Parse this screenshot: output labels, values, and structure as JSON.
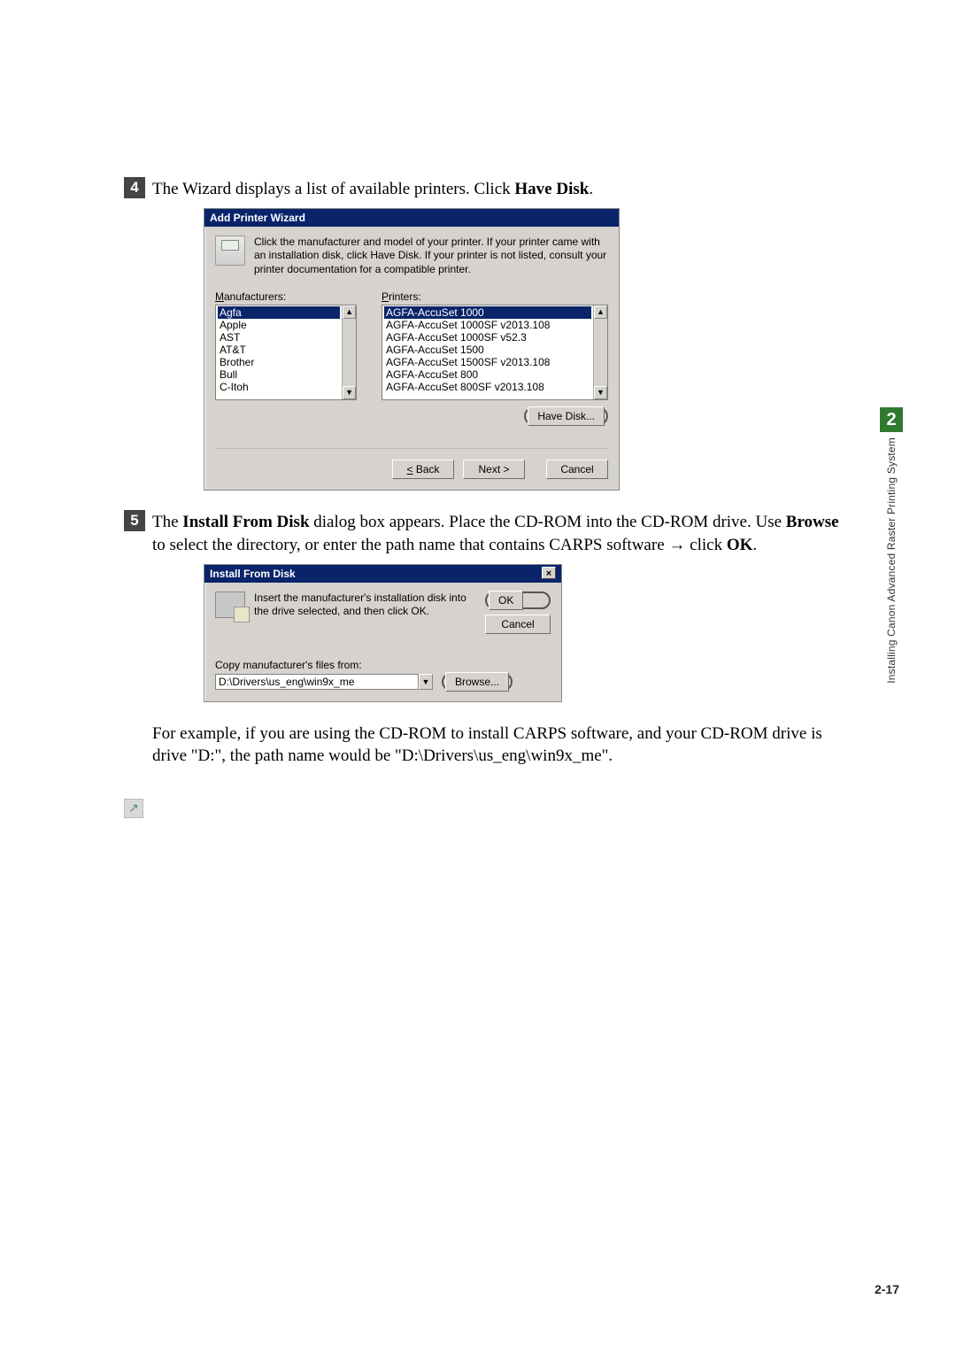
{
  "step4": {
    "num": "4",
    "text_before": "The Wizard displays a list of available printers. Click ",
    "bold": "Have Disk",
    "text_after": "."
  },
  "addPrinterWizard": {
    "title": "Add Printer Wizard",
    "intro": "Click the manufacturer and model of your printer. If your printer came with an installation disk, click Have Disk. If your printer is not listed, consult your printer documentation for a compatible printer.",
    "manu_label": "Manufacturers:",
    "printers_label": "Printers:",
    "manufacturers": [
      "Agfa",
      "Apple",
      "AST",
      "AT&T",
      "Brother",
      "Bull",
      "C-Itoh"
    ],
    "printers": [
      "AGFA-AccuSet 1000",
      "AGFA-AccuSet 1000SF v2013.108",
      "AGFA-AccuSet 1000SF v52.3",
      "AGFA-AccuSet 1500",
      "AGFA-AccuSet 1500SF v2013.108",
      "AGFA-AccuSet 800",
      "AGFA-AccuSet 800SF v2013.108"
    ],
    "have_disk": "Have Disk...",
    "back": "< Back",
    "next": "Next >",
    "cancel": "Cancel"
  },
  "step5": {
    "num": "5",
    "t1": "The ",
    "b1": "Install From Disk",
    "t2": " dialog box appears. Place the CD-ROM into the CD-ROM drive. Use ",
    "b2": "Browse",
    "t3": " to select the directory, or enter the path name that contains CARPS software ",
    "arrow": "→",
    "t4": " click ",
    "b3": "OK",
    "t5": "."
  },
  "installFromDisk": {
    "title": "Install From Disk",
    "intro": "Insert the manufacturer's installation disk into the drive selected, and then click OK.",
    "ok": "OK",
    "cancel": "Cancel",
    "copy_label": "Copy manufacturer's files from:",
    "path": "D:\\Drivers\\us_eng\\win9x_me",
    "browse": "Browse..."
  },
  "example": "For example, if you are using the CD-ROM to install CARPS software, and your CD-ROM drive is drive \"D:\", the path name would be \"D:\\Drivers\\us_eng\\win9x_me\".",
  "sidebar": {
    "chapter": "2",
    "caption": "Installing Canon Advanced Raster Printing System"
  },
  "pagenum": "2-17"
}
